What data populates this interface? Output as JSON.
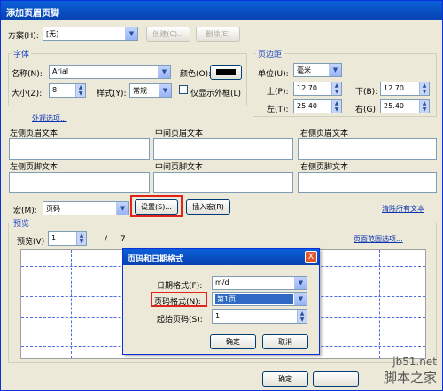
{
  "window": {
    "title": "添加页眉页脚"
  },
  "scheme": {
    "label": "方案(H):",
    "value": "[无]",
    "create_button": "创建(C)...",
    "delete_button": "删除(E)"
  },
  "font": {
    "group_title": "字体",
    "name_label": "名称(N):",
    "name_value": "Arial",
    "color_label": "颜色(O):",
    "color_value": "#000000",
    "size_label": "大小(Z):",
    "size_value": "8",
    "style_label": "样式(Y):",
    "style_value": "常规",
    "outline_checkbox": "仅显示外框(L)"
  },
  "margins": {
    "group_title": "页边距",
    "unit_label": "单位(U):",
    "unit_value": "毫米",
    "top_label": "上(P):",
    "top_value": "12.70",
    "bottom_label": "下(B):",
    "bottom_value": "12.70",
    "left_label": "左(T):",
    "left_value": "25.40",
    "right_label": "右(G):",
    "right_value": "25.40"
  },
  "appearance_link": "外观选项...",
  "header_text": {
    "left": "左侧页眉文本",
    "center": "中间页眉文本",
    "right": "右侧页眉文本"
  },
  "footer_text": {
    "left": "左侧页脚文本",
    "center": "中间页脚文本",
    "right": "右侧页脚文本"
  },
  "macro": {
    "label": "宏(M):",
    "value": "页码",
    "settings_button": "设置(S)...",
    "insert_button": "插入宏(R)",
    "clear_link": "清除所有文本"
  },
  "preview": {
    "group_title": "预览",
    "page_label": "预览(V)",
    "page_value": "1",
    "page_separator": "/",
    "page_total": "7",
    "range_link": "页面范围选项..."
  },
  "footer_buttons": {
    "ok": "确定"
  },
  "subdialog": {
    "title": "页码和日期格式",
    "close": "X",
    "date_format_label": "日期格式(F):",
    "date_format_value": "m/d",
    "page_format_label": "页码格式(N):",
    "page_format_value": "第1页",
    "start_page_label": "起始页码(S):",
    "start_page_value": "1",
    "ok_button": "确定",
    "cancel_button": "取消"
  },
  "watermark": {
    "url": "jb51.net",
    "name": "脚本之家"
  },
  "colors": {
    "accent": "#0842b0",
    "highlight_red": "#e0241b",
    "link": "#0a32b4"
  }
}
